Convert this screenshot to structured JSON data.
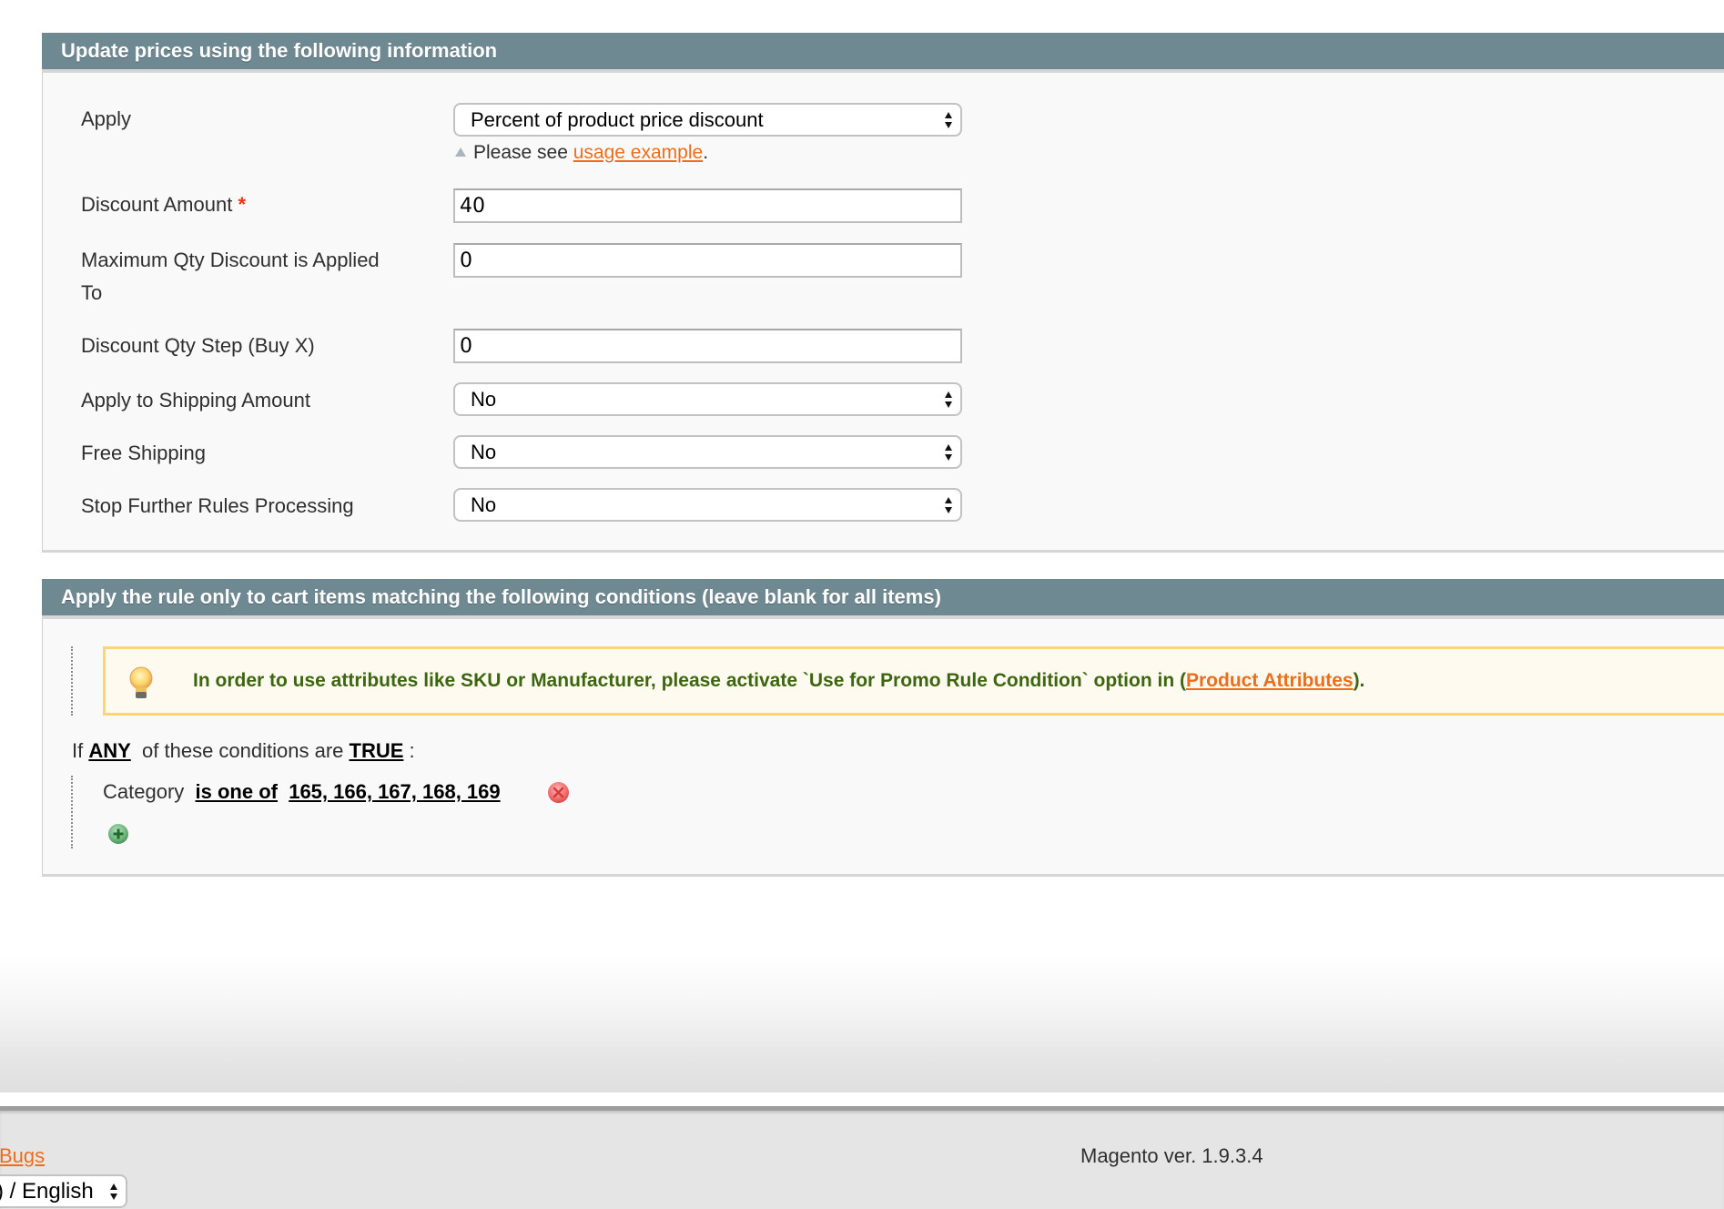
{
  "actions_section": {
    "title": "Update prices using the following information",
    "apply": {
      "label": "Apply",
      "value": "Percent of product price discount",
      "hint_prefix": "Please see ",
      "hint_link": "usage example",
      "hint_suffix": "."
    },
    "discount_amount": {
      "label": "Discount Amount",
      "required_mark": "*",
      "value": "40"
    },
    "max_qty": {
      "label_line1": "Maximum Qty Discount is Applied",
      "label_line2": "To",
      "value": "0"
    },
    "discount_step": {
      "label": "Discount Qty Step (Buy X)",
      "value": "0"
    },
    "apply_to_shipping": {
      "label": "Apply to Shipping Amount",
      "value": "No"
    },
    "free_shipping": {
      "label": "Free Shipping",
      "value": "No"
    },
    "stop_processing": {
      "label": "Stop Further Rules Processing",
      "value": "No"
    }
  },
  "conditions_section": {
    "title": "Apply the rule only to cart items matching the following conditions (leave blank for all items)",
    "notice": {
      "text": "In order to use attributes like SKU or Manufacturer, please activate `Use for Promo Rule Condition` option in (",
      "link": "Product Attributes",
      "suffix": ")."
    },
    "aggregator": {
      "prefix": "If ",
      "aggregator_value": "ANY",
      "middle": "  of these conditions are ",
      "value": "TRUE",
      "suffix": " :"
    },
    "condition": {
      "attribute": "Category",
      "operator": "is one of",
      "value": "165, 166, 167, 168, 169"
    },
    "icons": {
      "remove": "remove-condition-icon",
      "add": "add-condition-icon",
      "notice": "lightbulb-icon"
    }
  },
  "footer": {
    "bugs_link": "l Bugs",
    "locale_value": ") / English",
    "version": "Magento ver. 1.9.3.4"
  },
  "colors": {
    "section_header": "#6f8992",
    "link": "#eb6e1c",
    "notice_text": "#3d6611",
    "notice_border": "#fbd577",
    "required": "#eb340a"
  }
}
